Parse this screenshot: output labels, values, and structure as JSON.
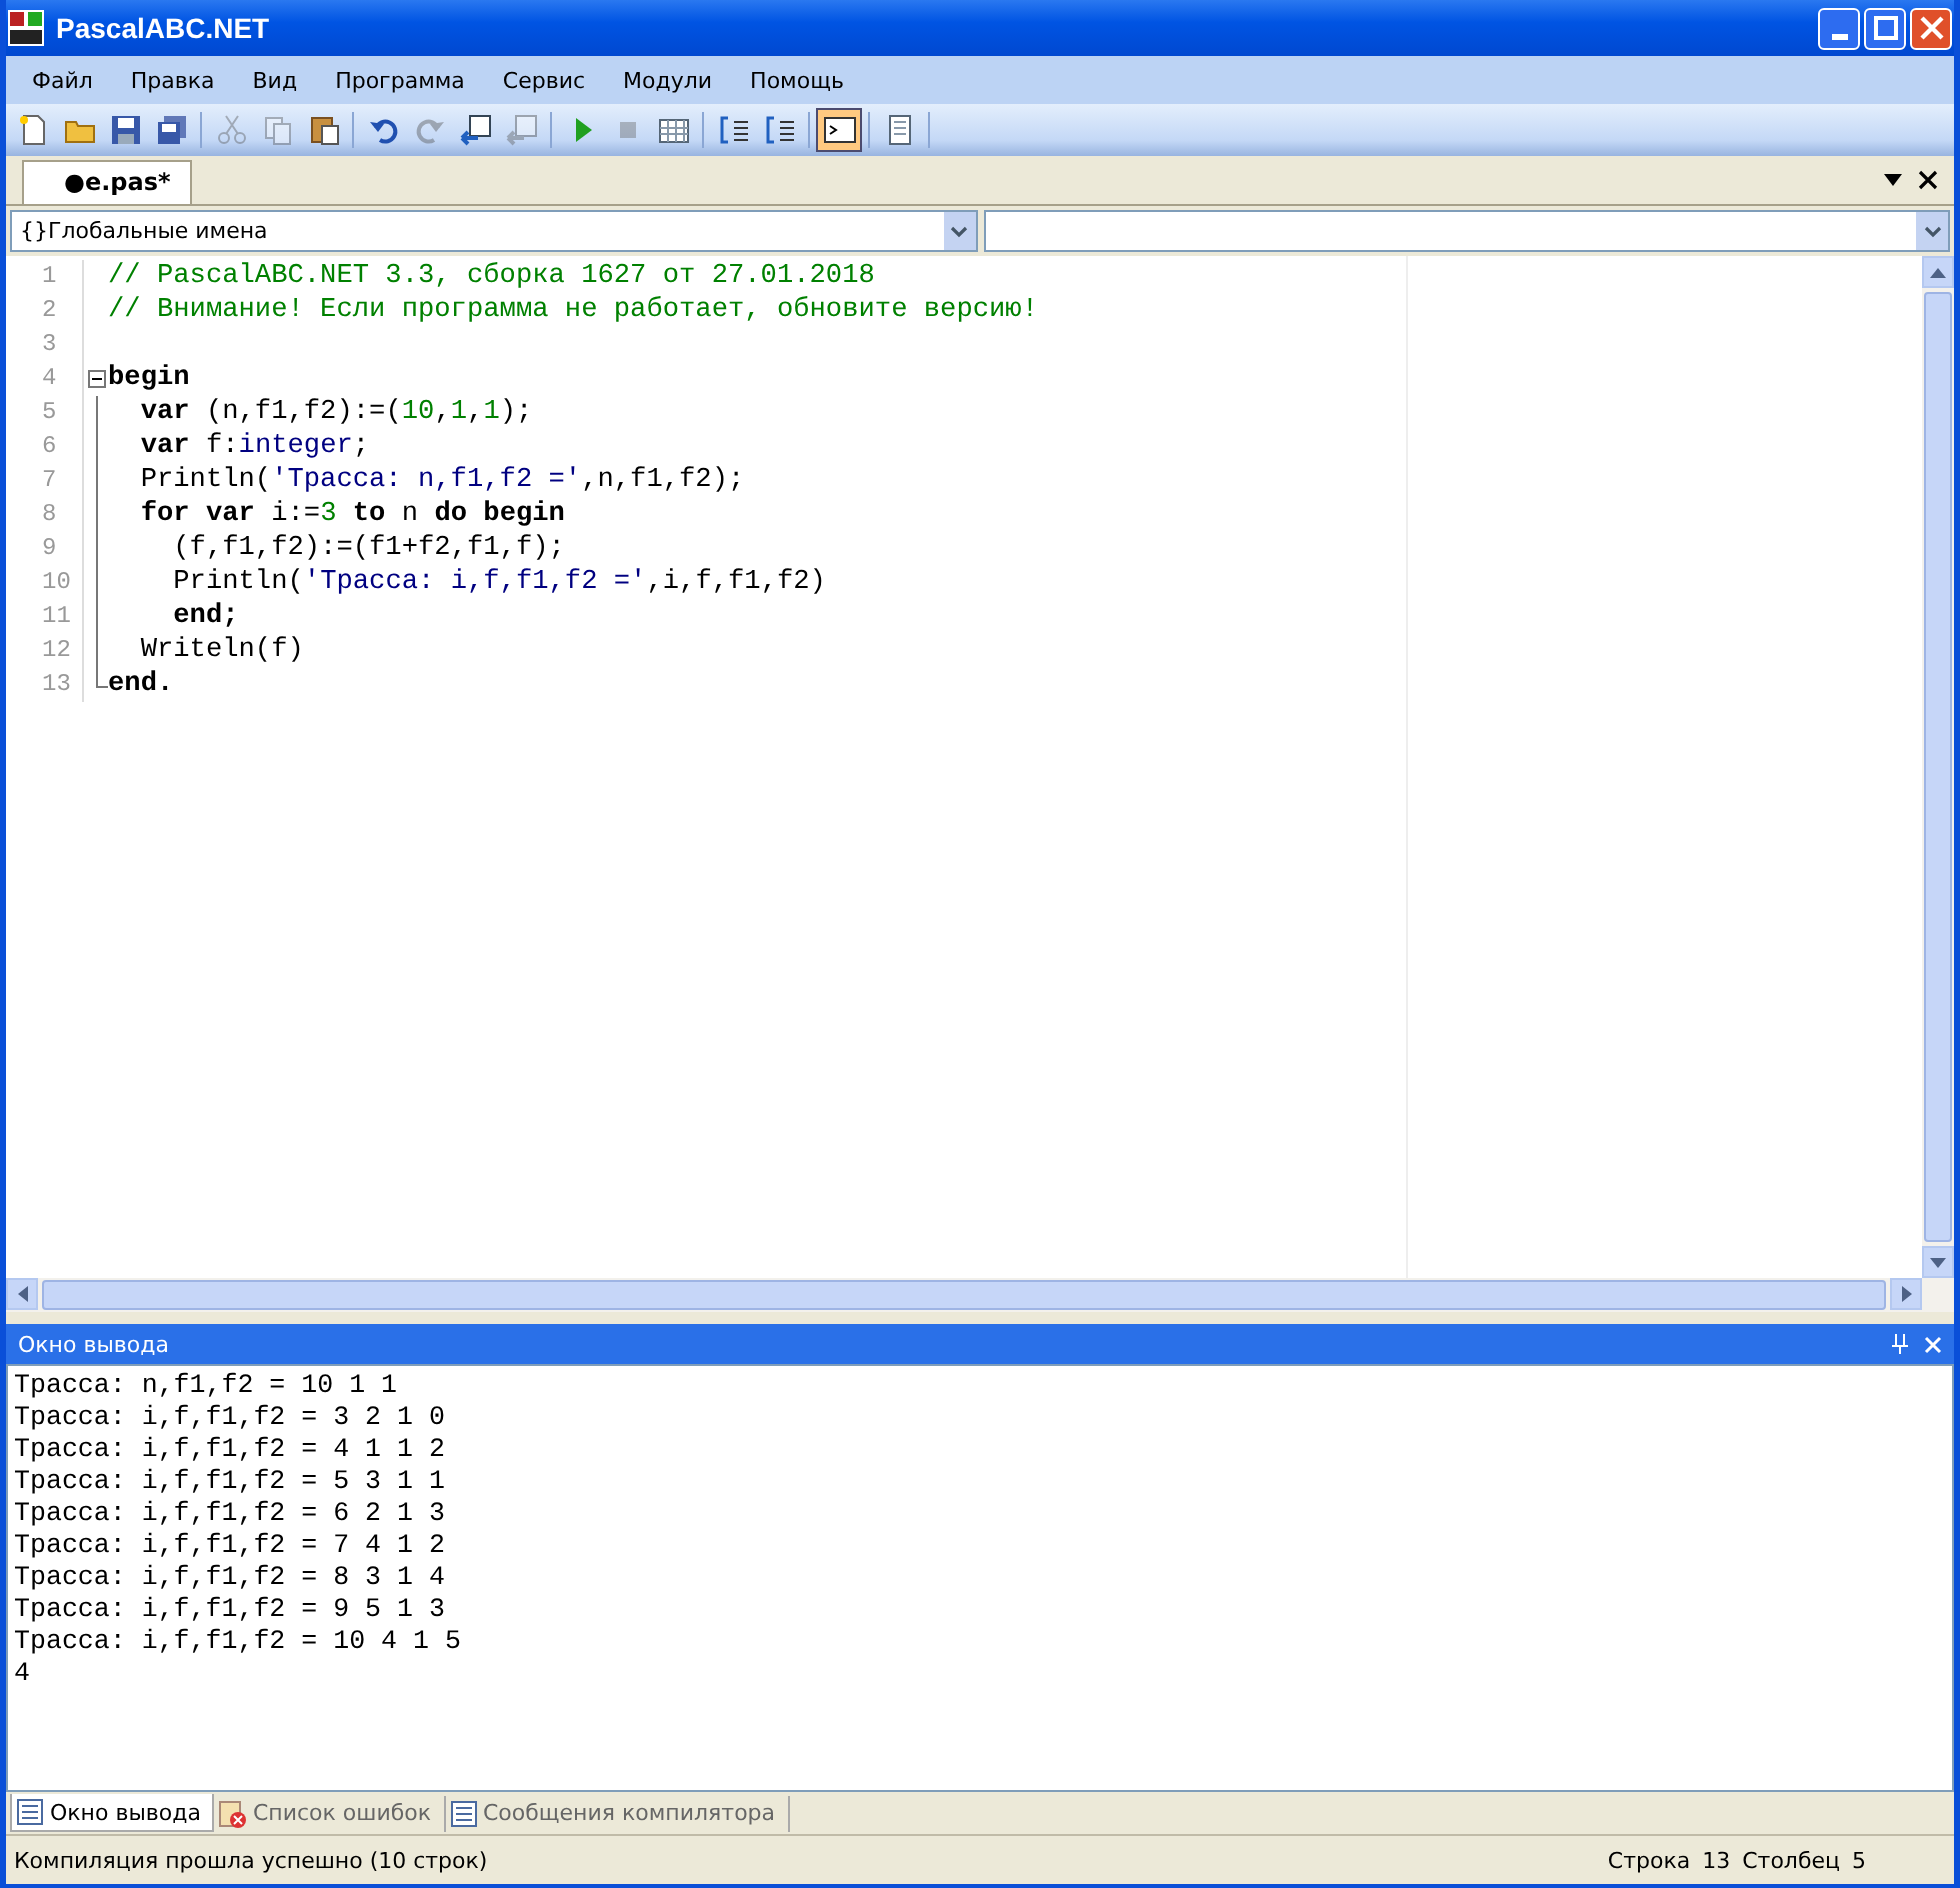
{
  "window": {
    "title": "PascalABC.NET"
  },
  "menu": [
    "Файл",
    "Правка",
    "Вид",
    "Программа",
    "Сервис",
    "Модули",
    "Помощь"
  ],
  "toolbar": [
    {
      "kind": "new",
      "disabled": false,
      "selected": false
    },
    {
      "kind": "open",
      "disabled": false,
      "selected": false
    },
    {
      "kind": "save",
      "disabled": false,
      "selected": false
    },
    {
      "kind": "save-all",
      "disabled": false,
      "selected": false
    },
    {
      "kind": "separator"
    },
    {
      "kind": "cut",
      "disabled": true,
      "selected": false
    },
    {
      "kind": "copy",
      "disabled": true,
      "selected": false
    },
    {
      "kind": "paste",
      "disabled": false,
      "selected": false
    },
    {
      "kind": "separator"
    },
    {
      "kind": "undo",
      "disabled": false,
      "selected": false
    },
    {
      "kind": "redo",
      "disabled": true,
      "selected": false
    },
    {
      "kind": "back",
      "disabled": false,
      "selected": false
    },
    {
      "kind": "forward",
      "disabled": true,
      "selected": false
    },
    {
      "kind": "separator"
    },
    {
      "kind": "run",
      "disabled": false,
      "selected": false
    },
    {
      "kind": "stop",
      "disabled": true,
      "selected": false
    },
    {
      "kind": "compile",
      "disabled": false,
      "selected": false
    },
    {
      "kind": "separator"
    },
    {
      "kind": "step-into",
      "disabled": false,
      "selected": false
    },
    {
      "kind": "step-over",
      "disabled": false,
      "selected": false
    },
    {
      "kind": "separator"
    },
    {
      "kind": "console",
      "disabled": false,
      "selected": true
    },
    {
      "kind": "separator"
    },
    {
      "kind": "document",
      "disabled": false,
      "selected": false
    },
    {
      "kind": "separator"
    }
  ],
  "file_tabs": [
    {
      "label": "●e.pas*",
      "selected": true
    }
  ],
  "scope_combo": {
    "value": "{}Глобальные имена"
  },
  "code": [
    {
      "number": "1",
      "kind": "plain",
      "tokens": [
        {
          "text": "// PascalABC.NET 3.3, сборка 1627 от 27.01.2018",
          "kind": "comment"
        }
      ]
    },
    {
      "number": "2",
      "kind": "plain",
      "tokens": [
        {
          "text": "// Внимание! Если программа не работает, обновите версию!",
          "kind": "comment"
        }
      ]
    },
    {
      "number": "3",
      "kind": "plain"
    },
    {
      "number": "4",
      "kind": "fold-start",
      "tokens": [
        {
          "text": "begin",
          "kind": "keyword"
        }
      ]
    },
    {
      "number": "5",
      "kind": "fold-body",
      "tokens": [
        {
          "text": "  var",
          "kind": "keyword"
        },
        {
          "text": " (n,f1,f2):=(",
          "kind": "plain"
        },
        {
          "text": "10",
          "kind": "number"
        },
        {
          "text": ",",
          "kind": "plain"
        },
        {
          "text": "1",
          "kind": "number"
        },
        {
          "text": ",",
          "kind": "plain"
        },
        {
          "text": "1",
          "kind": "number"
        },
        {
          "text": ");",
          "kind": "plain"
        }
      ]
    },
    {
      "number": "6",
      "kind": "fold-body",
      "tokens": [
        {
          "text": "  var",
          "kind": "keyword"
        },
        {
          "text": " f:",
          "kind": "plain"
        },
        {
          "text": "integer",
          "kind": "type"
        },
        {
          "text": ";",
          "kind": "plain"
        }
      ]
    },
    {
      "number": "7",
      "kind": "fold-body",
      "tokens": [
        {
          "text": "  Println(",
          "kind": "plain"
        },
        {
          "text": "'Трасса: n,f1,f2 ='",
          "kind": "string"
        },
        {
          "text": ",n,f1,f2);",
          "kind": "plain"
        }
      ]
    },
    {
      "number": "8",
      "kind": "fold-body",
      "tokens": [
        {
          "text": "  for var",
          "kind": "keyword"
        },
        {
          "text": " i:=",
          "kind": "plain"
        },
        {
          "text": "3",
          "kind": "number"
        },
        {
          "text": " to",
          "kind": "keyword"
        },
        {
          "text": " n ",
          "kind": "plain"
        },
        {
          "text": "do begin",
          "kind": "keyword"
        }
      ]
    },
    {
      "number": "9",
      "kind": "fold-body",
      "tokens": [
        {
          "text": "    (f,f1,f2):=(f1+f2,f1,f);",
          "kind": "plain"
        }
      ]
    },
    {
      "number": "10",
      "kind": "fold-body",
      "tokens": [
        {
          "text": "    Println(",
          "kind": "plain"
        },
        {
          "text": "'Трасса: i,f,f1,f2 ='",
          "kind": "string"
        },
        {
          "text": ",i,f,f1,f2)",
          "kind": "plain"
        }
      ]
    },
    {
      "number": "11",
      "kind": "fold-body",
      "tokens": [
        {
          "text": "    end;",
          "kind": "keyword"
        }
      ]
    },
    {
      "number": "12",
      "kind": "fold-body",
      "tokens": [
        {
          "text": "  Writeln(f)",
          "kind": "plain"
        }
      ]
    },
    {
      "number": "13",
      "kind": "fold-end",
      "tokens": [
        {
          "text": "end.",
          "kind": "keyword"
        }
      ]
    }
  ],
  "output_panel": {
    "title": "Окно вывода",
    "lines": [
      "Трасса: n,f1,f2 = 10 1 1",
      "Трасса: i,f,f1,f2 = 3 2 1 0",
      "Трасса: i,f,f1,f2 = 4 1 1 2",
      "Трасса: i,f,f1,f2 = 5 3 1 1",
      "Трасса: i,f,f1,f2 = 6 2 1 3",
      "Трасса: i,f,f1,f2 = 7 4 1 2",
      "Трасса: i,f,f1,f2 = 8 3 1 4",
      "Трасса: i,f,f1,f2 = 9 5 1 3",
      "Трасса: i,f,f1,f2 = 10 4 1 5",
      "4"
    ]
  },
  "bottom_tabs": [
    {
      "label": "Окно вывода",
      "kind": "output",
      "selected": true
    },
    {
      "label": "Список ошибок",
      "kind": "errors",
      "selected": false
    },
    {
      "label": "Сообщения компилятора",
      "kind": "messages",
      "selected": false
    }
  ],
  "status_bar": {
    "message": "Компиляция прошла успешно (10 строк)",
    "line_label": "Строка",
    "line": "13",
    "column_label": "Столбец",
    "column": "5"
  }
}
